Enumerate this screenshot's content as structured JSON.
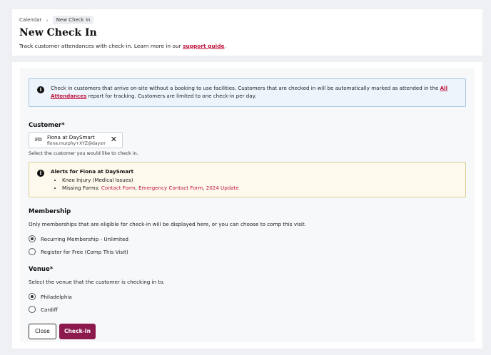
{
  "breadcrumb": {
    "parent": "Calendar",
    "separator": "›",
    "current": "New Check In"
  },
  "header": {
    "title": "New Check In",
    "description_prefix": "Track customer attendances with check-in. Learn more in our ",
    "description_link": "support guide",
    "description_suffix": "."
  },
  "info_banner": {
    "icon": "info-icon",
    "text_prefix": "Check in customers that arrive on-site without a booking to use facilities. Customers that are checked in will be automatically marked as attended in the ",
    "link": "All Attendances",
    "text_suffix": " report for tracking. Customers are limited to one check-in per day."
  },
  "customer": {
    "label": "Customer*",
    "initials": "FD",
    "name": "Fiona at DaySmart",
    "email": "fiona.murphy+XYZ@daysma",
    "remove_icon": "close-icon",
    "helper": "Select the customer you would like to check in."
  },
  "alerts": {
    "title": "Alerts for Fiona at DaySmart",
    "item1": "Knee Injury (Medical Issues)",
    "missing_prefix": "Missing Forms: ",
    "forms": [
      "Contact Form",
      "Emergency Contact Form",
      "2024 Update"
    ],
    "form_separator": ", "
  },
  "membership": {
    "label": "Membership",
    "description": "Only memberships that are eligible for check-in will be displayed here, or you can choose to comp this visit.",
    "options": [
      "Recurring Membership - Unlimited",
      "Register for Free (Comp This Visit)"
    ],
    "selected": "Recurring Membership - Unlimited"
  },
  "venue": {
    "label": "Venue*",
    "description": "Select the venue that the customer is checking in to.",
    "options": [
      "Philadelphia",
      "Cardiff"
    ],
    "selected": "Philadelphia"
  },
  "actions": {
    "close_label": "Close",
    "checkin_label": "Check-In"
  },
  "colors": {
    "accent": "#8c1a4d",
    "link": "#c0143c",
    "info_bg": "#edf4fb",
    "alert_bg": "#fdf9ec"
  }
}
